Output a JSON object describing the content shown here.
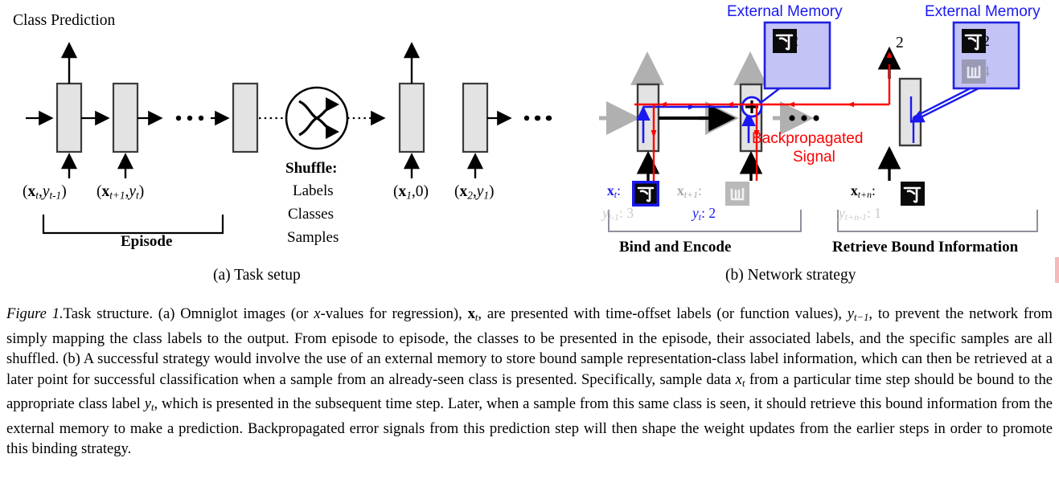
{
  "figure": {
    "label": "Figure 1.",
    "caption_parts": [
      "Task structure. (a) Omniglot images (or ",
      "x",
      "-values for regression), ",
      "x",
      "t",
      ", are presented with time-offset labels (or function values), ",
      "y",
      "t−1",
      ", to prevent the network from simply mapping the class labels to the output. From episode to episode, the classes to be presented in the episode, their associated labels, and the specific samples are all shuffled. (b) A successful strategy would involve the use of an external memory to store bound sample representation-class label information, which can then be retrieved at a later point for successful classification when a sample from an already-seen class is presented. Specifically, sample data ",
      "x",
      "t",
      " from a particular time step should be bound to the appropriate class label ",
      "y",
      "t",
      ", which is presented in the subsequent time step. Later, when a sample from this same class is seen, it should retrieve this bound information from the external memory to make a prediction. Backpropagated error signals from this prediction step will then shape the weight updates from the earlier steps in order to promote this binding strategy."
    ]
  },
  "panel_a": {
    "caption": "(a) Task setup",
    "class_prediction_label": "Class Prediction",
    "shuffle_title": "Shuffle:",
    "shuffle_items": [
      "Labels",
      "Classes",
      "Samples"
    ],
    "episode_label": "Episode",
    "inputs": [
      {
        "x": "x",
        "x_sub": "t",
        "y": "y",
        "y_sub": "t-1"
      },
      {
        "x": "x",
        "x_sub": "t+1",
        "y": "y",
        "y_sub": "t"
      },
      {
        "x": "x",
        "x_sub": "1",
        "y": "0",
        "y_sub": ""
      },
      {
        "x": "x",
        "x_sub": "2",
        "y": "y",
        "y_sub": "1"
      }
    ],
    "num_controllers": 5
  },
  "panel_b": {
    "caption": "(b) Network strategy",
    "external_memory_label": "External Memory",
    "backprop_label_line1": "Backpropagated",
    "backprop_label_line2": "Signal",
    "bind_label": "Bind and Encode",
    "retrieve_label": "Retrieve Bound Information",
    "output_value": "2",
    "memory_left": {
      "rows": [
        {
          "glyph": "omniglot-char-a",
          "value": "-2",
          "dim": false
        }
      ]
    },
    "memory_right": {
      "rows": [
        {
          "glyph": "omniglot-char-a",
          "value": "-2",
          "dim": false
        },
        {
          "glyph": "omniglot-char-b",
          "value": "-4",
          "dim": true
        }
      ]
    },
    "timesteps": [
      {
        "x_label": "x",
        "x_sub": "t",
        "glyph": "omniglot-char-a",
        "x_color": "#1a19f0",
        "highlight": true,
        "y_label": "y",
        "y_sub": "t-1",
        "y_value": "3",
        "y_color": "#c9c9c9"
      },
      {
        "x_label": "x",
        "x_sub": "t+1",
        "glyph": "omniglot-char-b",
        "x_color": "#a6a6a6",
        "highlight": false,
        "y_label": "y",
        "y_sub": "t",
        "y_value": "2",
        "y_color": "#1a19f0"
      },
      {
        "x_label": "x",
        "x_sub": "t+n",
        "glyph": "omniglot-char-a",
        "x_color": "#000000",
        "highlight": false,
        "y_label": "y",
        "y_sub": "t+n-1",
        "y_value": "1",
        "y_color": "#c9c9c9"
      }
    ]
  },
  "colors": {
    "memory_fill": "#c3c3f5",
    "memory_border": "#2020e0",
    "blue": "#1a19f0",
    "red": "#fd0000",
    "grey_arrow": "#b0b0b0",
    "controller_fill": "#e3e3e3",
    "controller_border": "#3b3b3b"
  }
}
